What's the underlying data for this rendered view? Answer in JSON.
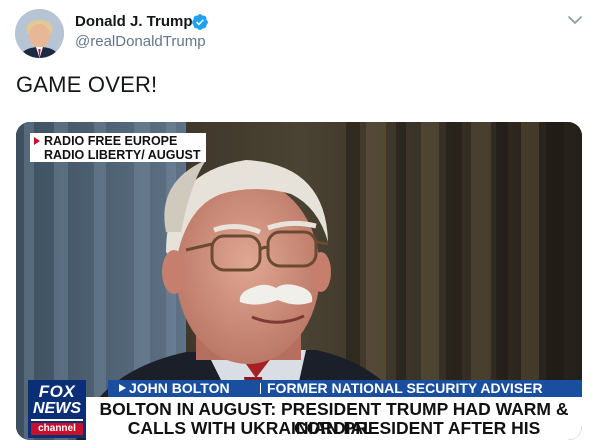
{
  "author": {
    "name": "Donald J. Trump",
    "handle": "@realDonaldTrump",
    "verified": true
  },
  "tweet": {
    "text": "GAME OVER!"
  },
  "media": {
    "source_tag": {
      "line1": "RADIO FREE EUROPE",
      "line2": "RADIO LIBERTY/ AUGUST"
    },
    "chyron": {
      "name": "JOHN BOLTON",
      "title": "FORMER NATIONAL SECURITY ADVISER",
      "headline_line1": "BOLTON IN AUGUST: PRESIDENT TRUMP HAD WARM & CORDIAL",
      "headline_line2": "CALLS WITH UKRAINIAN PRESIDENT AFTER HIS ELECTION"
    },
    "network_logo": {
      "line1": "FOX",
      "line2": "NEWS",
      "line3": "channel"
    }
  },
  "icons": {
    "verified": "verified-badge-icon",
    "caret": "chevron-down-icon"
  },
  "colors": {
    "verified_blue": "#1da1f2",
    "handle_gray": "#657786",
    "chyron_blue": "#1a4e9f",
    "fox_navy": "#0b2f77",
    "fox_red": "#c8102e"
  }
}
